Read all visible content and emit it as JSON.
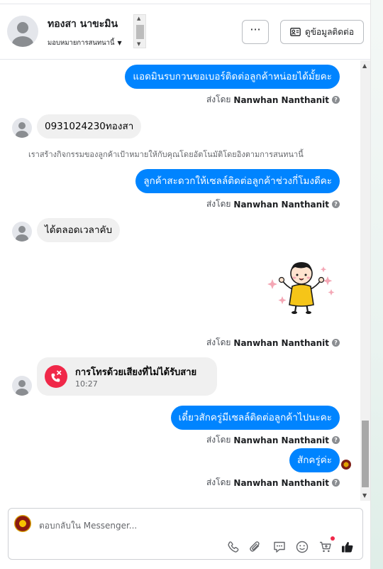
{
  "header": {
    "contact_name": "ทองสา นาขะมิน",
    "assign_label": "มอบหมายการสนทนานี้",
    "more_label": "···",
    "view_contact_label": "ดูข้อมูลติดต่อ"
  },
  "messages": {
    "out1": "แอดมินรบกวนขอเบอร์ติดต่อลูกค้าหน่อยได้มั้ยคะ",
    "sent_prefix": "ส่งโดย",
    "sender": "Nanwhan Nanthanit",
    "help_glyph": "?",
    "in1": "0931024230ทองสา",
    "system_note": "เราสร้างกิจกรรมของลูกค้าเป้าหมายให้กับคุณโดยอัตโนมัติโดยอิงตามการสนทนานี้",
    "out2": "ลูกค้าสะดวกให้เซลล์ติดต่อลูกค้าช่วงกี่โมงดีคะ",
    "in2": "ได้ตลอดเวลาคับ",
    "missed_call_title": "การโทรด้วยเสียงที่ไม่ได้รับสาย",
    "missed_call_time": "10:27",
    "out3": "เดี๋ยวสักครู่มีเซลล์ติดต่อลูกค้าไปนะคะ",
    "out4": "สักครู่ค่ะ"
  },
  "composer": {
    "placeholder": "ตอบกลับใน Messenger..."
  },
  "icons": {
    "call": "phone-icon",
    "attach": "paperclip-icon",
    "saved_replies": "chat-bubble-icon",
    "emoji": "emoji-icon",
    "cart": "cart-icon",
    "like": "thumbs-up-icon"
  },
  "colors": {
    "accent": "#0084ff",
    "missed_call": "#f02849",
    "incoming_bubble": "#f0f0f0"
  }
}
